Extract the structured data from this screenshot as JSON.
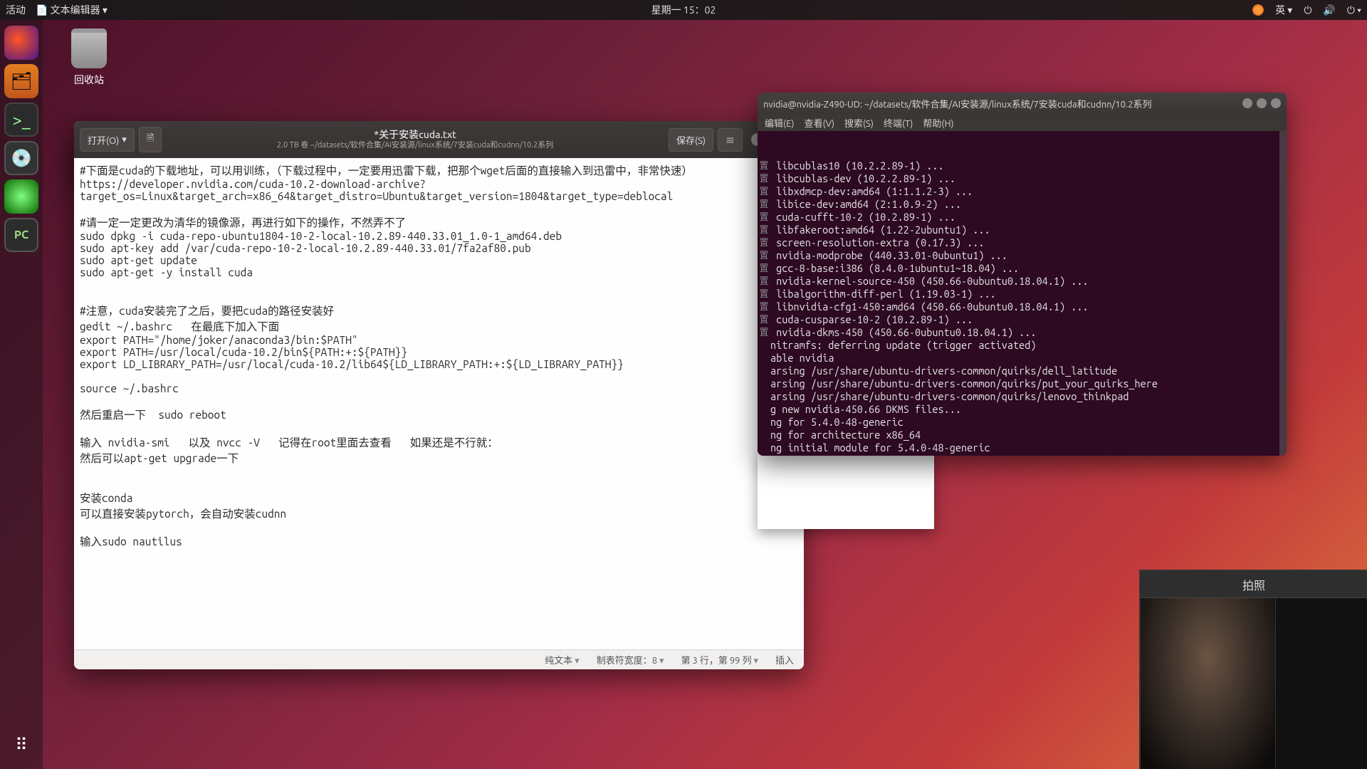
{
  "topbar": {
    "activities": "活动",
    "appmenu": "文本编辑器",
    "clock": "星期一 15：02",
    "ime_label": "英"
  },
  "desktop": {
    "trash": "回收站"
  },
  "gedit": {
    "open_label": "打开(O)",
    "save_label": "保存(S)",
    "title": "*关于安装cuda.txt",
    "subtitle": "2.0 TB 卷 ~/datasets/软件合集/AI安装源/linux系统/7安装cuda和cudnn/10.2系列",
    "content": "#下面是cuda的下载地址，可以用训练，（下载过程中，一定要用迅雷下载，把那个wget后面的直接输入到迅雷中，非常快速）\nhttps://developer.nvidia.com/cuda-10.2-download-archive?target_os=Linux&target_arch=x86_64&target_distro=Ubuntu&target_version=1804&target_type=deblocal\n\n#请一定一定更改为清华的镜像源，再进行如下的操作，不然弄不了\nsudo dpkg -i cuda-repo-ubuntu1804-10-2-local-10.2.89-440.33.01_1.0-1_amd64.deb\nsudo apt-key add /var/cuda-repo-10-2-local-10.2.89-440.33.01/7fa2af80.pub\nsudo apt-get update\nsudo apt-get -y install cuda\n\n\n#注意，cuda安装完了之后，要把cuda的路径安装好\ngedit ~/.bashrc   在最底下加入下面\nexport PATH=\"/home/joker/anaconda3/bin:$PATH\"\nexport PATH=/usr/local/cuda-10.2/bin${PATH:+:${PATH}}\nexport LD_LIBRARY_PATH=/usr/local/cuda-10.2/lib64${LD_LIBRARY_PATH:+:${LD_LIBRARY_PATH}}\n\nsource ~/.bashrc\n\n然后重启一下  sudo reboot\n\n输入 nvidia-smi   以及 nvcc -V   记得在root里面去查看   如果还是不行就：\n然后可以apt-get upgrade一下\n\n\n安装conda\n可以直接安装pytorch，会自动安装cudnn\n\n输入sudo nautilus\n",
    "status": {
      "plain": "纯文本",
      "tabwidth": "制表符宽度：8",
      "cursor": "第 3 行，第 99 列",
      "mode": "插入"
    }
  },
  "terminal": {
    "title": "nvidia@nvidia-Z490-UD: ~/datasets/软件合集/AI安装源/linux系统/7安装cuda和cudnn/10.2系列",
    "menu": {
      "edit": "编辑(E)",
      "view": "查看(V)",
      "search": "搜索(S)",
      "terminal": "终端(T)",
      "help": "帮助(H)"
    },
    "lines": [
      " libcublas10 (10.2.2.89-1) ...",
      " libcublas-dev (10.2.2.89-1) ...",
      " libxdmcp-dev:amd64 (1:1.1.2-3) ...",
      " libice-dev:amd64 (2:1.0.9-2) ...",
      " cuda-cufft-10-2 (10.2.89-1) ...",
      " libfakeroot:amd64 (1.22-2ubuntu1) ...",
      " screen-resolution-extra (0.17.3) ...",
      " nvidia-modprobe (440.33.01-0ubuntu1) ...",
      " gcc-8-base:i386 (8.4.0-1ubuntu1~18.04) ...",
      " nvidia-kernel-source-450 (450.66-0ubuntu0.18.04.1) ...",
      " libalgorithm-diff-perl (1.19.03-1) ...",
      " libnvidia-cfg1-450:amd64 (450.66-0ubuntu0.18.04.1) ...",
      " cuda-cusparse-10-2 (10.2.89-1) ...",
      " nvidia-dkms-450 (450.66-0ubuntu0.18.04.1) ...",
      "nitramfs: deferring update (trigger activated)",
      "able nvidia",
      "arsing /usr/share/ubuntu-drivers-common/quirks/dell_latitude",
      "arsing /usr/share/ubuntu-drivers-common/quirks/put_your_quirks_here",
      "arsing /usr/share/ubuntu-drivers-common/quirks/lenovo_thinkpad",
      "g new nvidia-450.66 DKMS files...",
      "ng for 5.4.0-48-generic",
      "ng for architecture x86_64",
      "ng initial module for 5.4.0-48-generic"
    ]
  },
  "webcam": {
    "tab": "拍照"
  }
}
